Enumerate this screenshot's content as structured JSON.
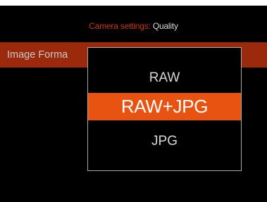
{
  "header": {
    "section": "Camera settings",
    "separator": ":",
    "current": "Quality"
  },
  "row": {
    "label": "Image Forma"
  },
  "popup": {
    "options": [
      {
        "label": "RAW",
        "selected": false
      },
      {
        "label": "RAW+JPG",
        "selected": true
      },
      {
        "label": "JPG",
        "selected": false
      }
    ]
  },
  "colors": {
    "background": "#000000",
    "accent_orange": "#e85312",
    "row_highlight": "#9a2a0b",
    "header_orange": "#c63a12",
    "text_light": "#d6d6d6",
    "popup_border": "#a9a9a9"
  }
}
